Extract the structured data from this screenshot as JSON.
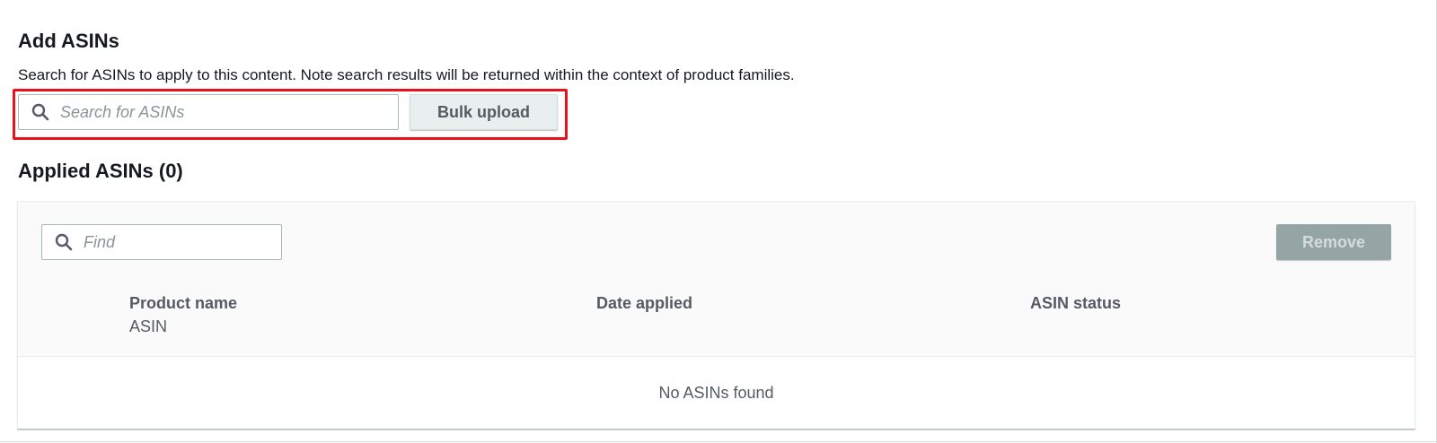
{
  "add_section": {
    "title": "Add ASINs",
    "description": "Search for ASINs to apply to this content. Note search results will be returned within the context of product families.",
    "search": {
      "icon": "search-icon",
      "placeholder": "Search for ASINs",
      "value": ""
    },
    "bulk_upload_label": "Bulk upload",
    "highlight_color": "#e8121b"
  },
  "applied_section": {
    "title": "Applied ASINs (0)",
    "find": {
      "icon": "search-icon",
      "placeholder": "Find",
      "value": ""
    },
    "remove_label": "Remove",
    "columns": {
      "product_name": "Product name",
      "asin": "ASIN",
      "date_applied": "Date applied",
      "asin_status": "ASIN status"
    },
    "empty_message": "No ASINs found"
  },
  "colors": {
    "text_primary": "#16191f",
    "text_secondary": "#545b64",
    "placeholder": "#879596",
    "disabled_button": "#95a5a6",
    "secondary_button": "#e9efef"
  }
}
